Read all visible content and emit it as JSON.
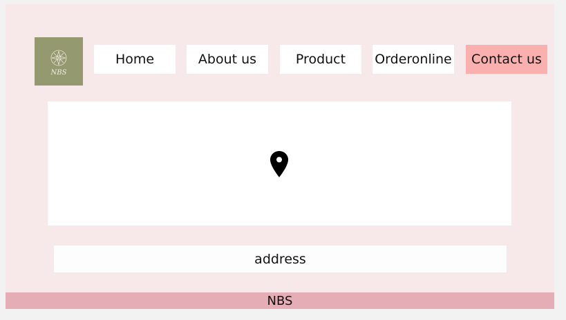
{
  "logo": {
    "text": "NBS"
  },
  "nav": {
    "home": "Home",
    "about": "About us",
    "product": "Product",
    "order": "Orderonline",
    "contact": "Contact us",
    "active": "Contact us"
  },
  "map": {
    "icon": "map-pin-icon"
  },
  "address": {
    "label": "address"
  },
  "footer": {
    "text": "NBS"
  },
  "colors": {
    "page_bg": "#f7e9e9",
    "logo_bg": "#95996f",
    "active_nav_bg": "#fbb0b0",
    "footer_bg": "#e5adb5"
  }
}
